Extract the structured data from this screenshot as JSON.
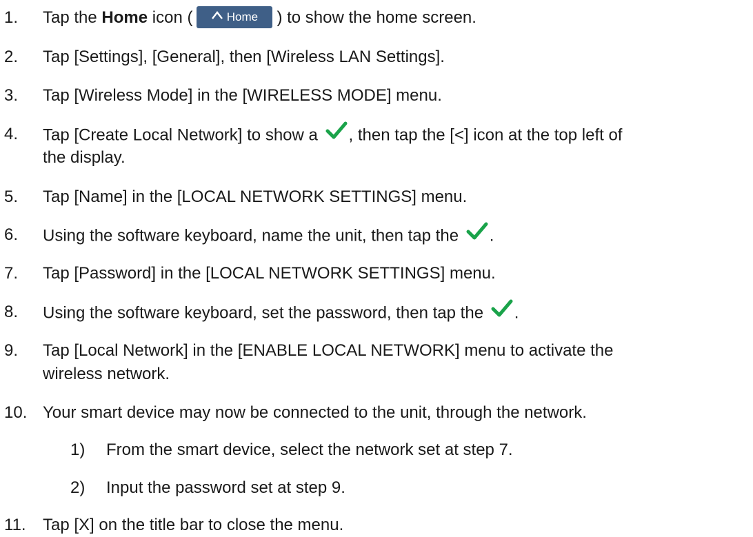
{
  "steps": [
    {
      "num": "1.",
      "pre": "Tap the ",
      "bold": "Home",
      "mid": " icon (",
      "button_label": "Home",
      "post": ") to show the home screen."
    },
    {
      "num": "2.",
      "text": "Tap [Settings], [General], then [Wireless LAN Settings]."
    },
    {
      "num": "3.",
      "text": "Tap [Wireless Mode] in the [WIRELESS MODE] menu."
    },
    {
      "num": "4.",
      "pre": "Tap [Create Local Network] to show a ",
      "post": ", then tap the [<] icon at the top left of",
      "line2": "the display."
    },
    {
      "num": "5.",
      "text": "Tap [Name] in the [LOCAL NETWORK SETTINGS] menu."
    },
    {
      "num": "6.",
      "pre": "Using the software keyboard, name the unit, then tap the ",
      "post": "."
    },
    {
      "num": "7.",
      "text": "Tap [Password] in the [LOCAL NETWORK SETTINGS] menu."
    },
    {
      "num": "8.",
      "pre": "Using the software keyboard, set the password, then tap the ",
      "post": "."
    },
    {
      "num": "9.",
      "text": "Tap [Local Network] in the [ENABLE LOCAL NETWORK] menu to activate the",
      "line2": "wireless network."
    },
    {
      "num": "10.",
      "text": "Your smart device may now be connected to the unit, through the network."
    },
    {
      "num": "11.",
      "text": "Tap [X] on the title bar to close the menu."
    }
  ],
  "substeps": [
    {
      "num": "1)",
      "text": "From the smart device, select the network set at step 7."
    },
    {
      "num": "2)",
      "text": "Input the password set at step 9."
    }
  ],
  "colors": {
    "check_green": "#1aa34a",
    "home_button_bg": "#3f5f87"
  },
  "icons": {
    "home": "home-icon",
    "check": "checkmark-icon"
  }
}
